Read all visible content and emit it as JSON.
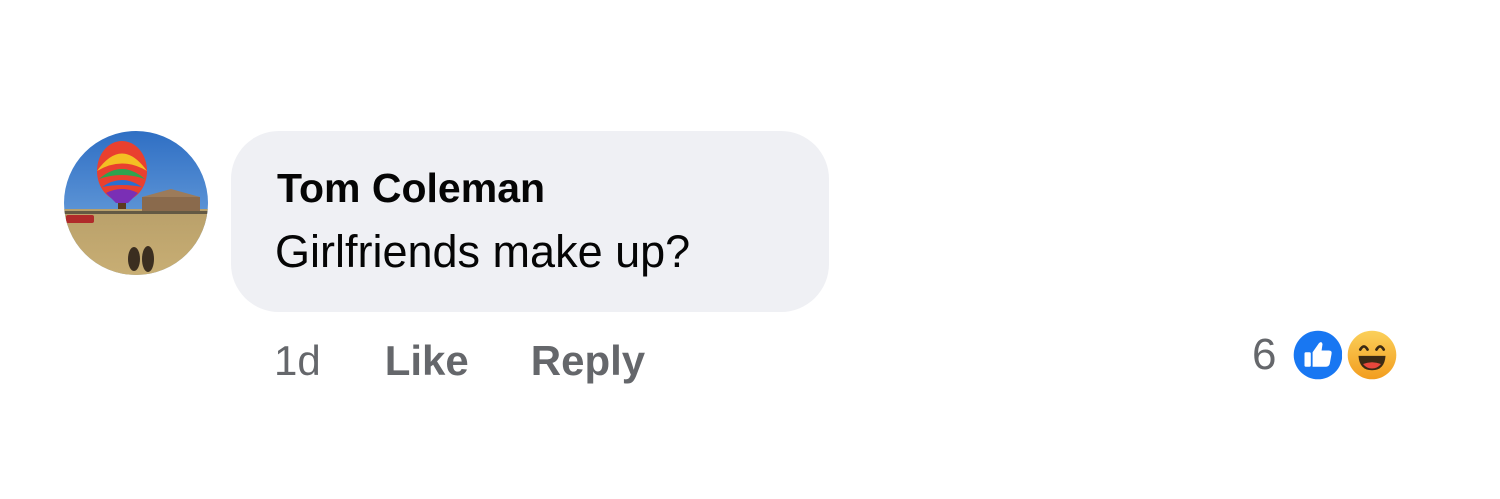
{
  "comment": {
    "author": "Tom Coleman",
    "text": "Girlfriends make up?",
    "timestamp": "1d",
    "actions": {
      "like_label": "Like",
      "reply_label": "Reply"
    },
    "reactions": {
      "count": "6",
      "types": [
        "like-icon",
        "haha-icon"
      ]
    },
    "avatar": {
      "icon": "hot-air-balloon-photo"
    }
  },
  "colors": {
    "bubble_background": "#eff0f4",
    "primary_text": "#050505",
    "secondary_text": "#65676b",
    "like_blue": "#1877f2",
    "haha_yellow": "#f7b928"
  }
}
